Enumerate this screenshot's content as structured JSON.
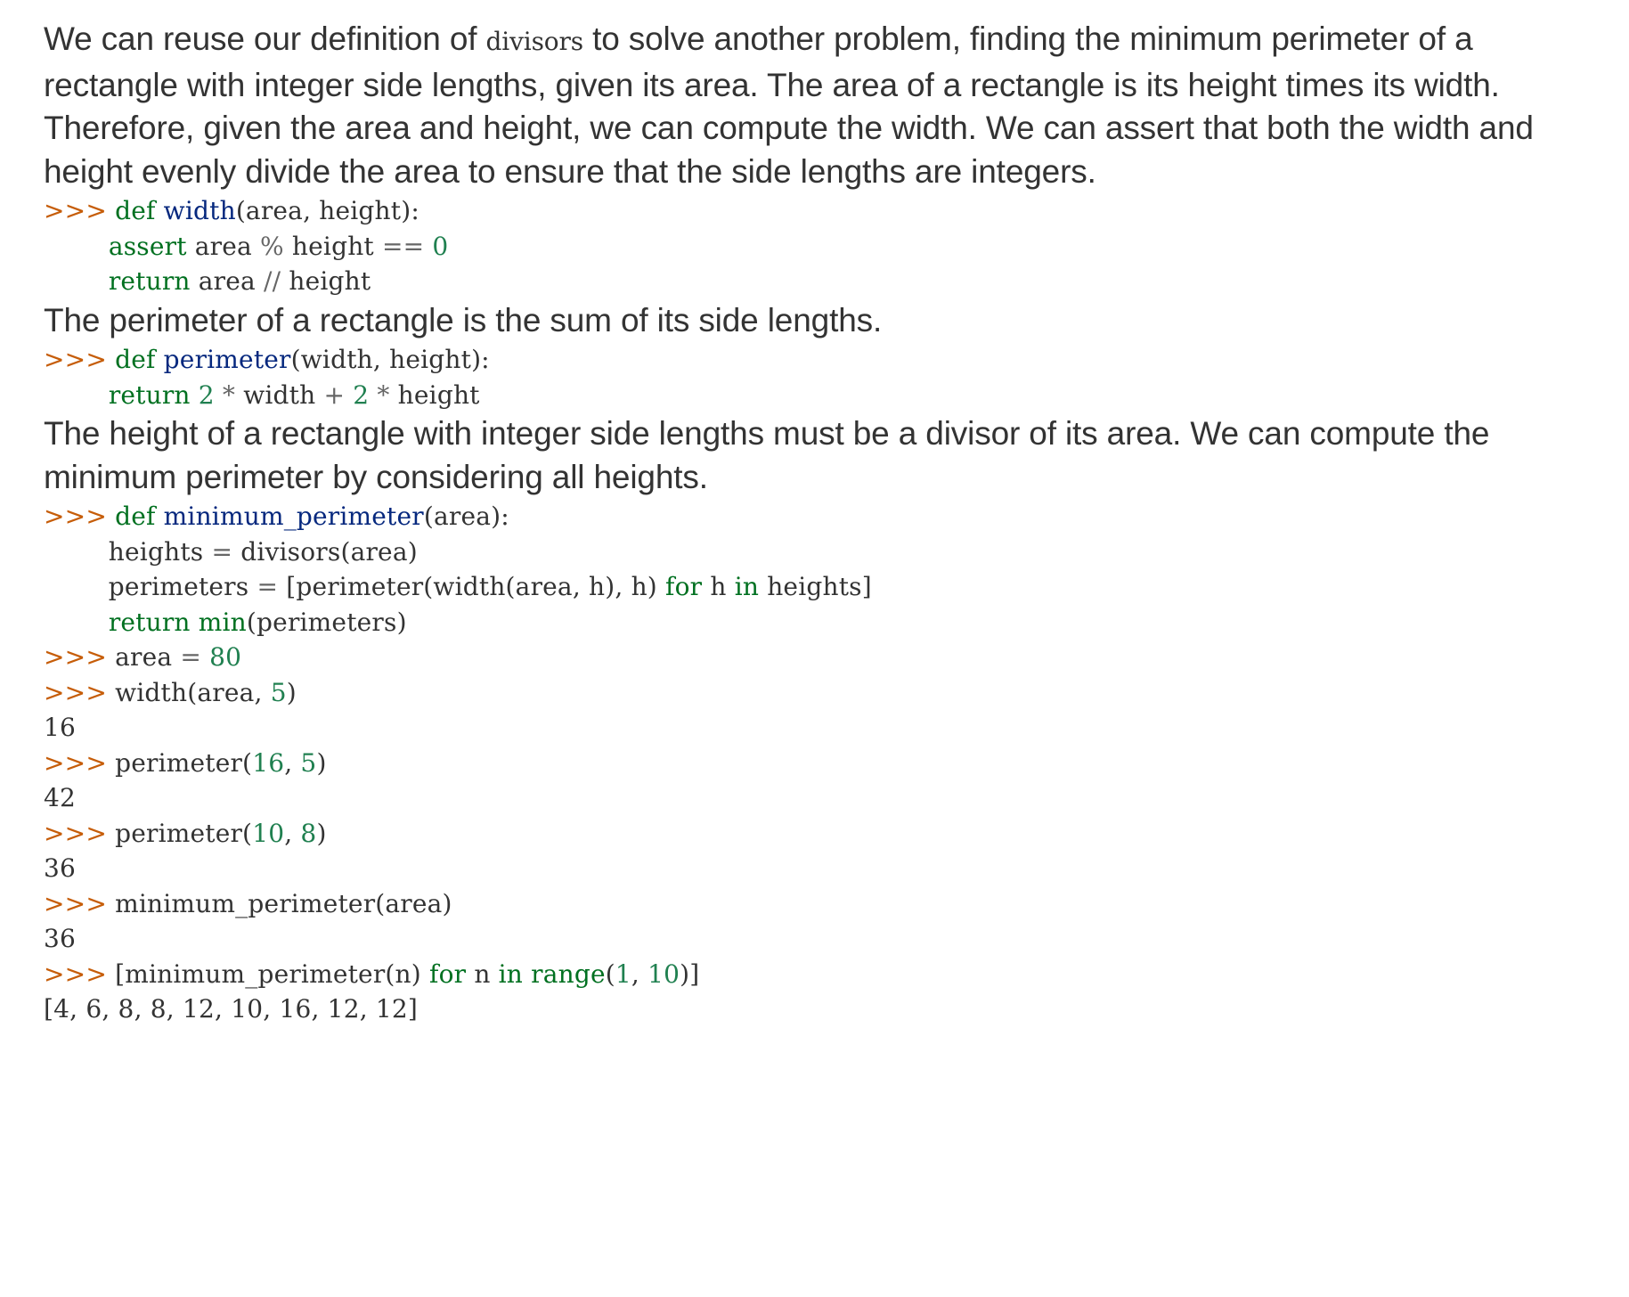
{
  "paragraph1": {
    "before": "We can reuse our definition of ",
    "code": "divisors",
    "after": " to solve another problem, finding the minimum perimeter of a rectangle with integer side lengths, given its area. The area of a rectangle is its height times its width. Therefore, given the area and height, we can compute the width. We can assert that both the width and height evenly divide the area to ensure that the side lengths are integers."
  },
  "paragraph2": "The perimeter of a rectangle is the sum of its side lengths.",
  "paragraph3": "The height of a rectangle with integer side lengths must be a divisor of its area. We can compute the minimum perimeter by considering all heights.",
  "code_width": [
    [
      [
        "prompt",
        ">>> "
      ],
      [
        "kw",
        "def"
      ],
      [
        "",
        " "
      ],
      [
        "fn",
        "width"
      ],
      [
        "",
        "(area, height):"
      ]
    ],
    [
      [
        "",
        "        "
      ],
      [
        "kw",
        "assert"
      ],
      [
        "",
        " area "
      ],
      [
        "op",
        "%"
      ],
      [
        "",
        " height "
      ],
      [
        "op",
        "=="
      ],
      [
        "",
        " "
      ],
      [
        "num",
        "0"
      ]
    ],
    [
      [
        "",
        "        "
      ],
      [
        "kw",
        "return"
      ],
      [
        "",
        " area "
      ],
      [
        "op",
        "//"
      ],
      [
        "",
        " height"
      ]
    ]
  ],
  "code_perimeter": [
    [
      [
        "prompt",
        ">>> "
      ],
      [
        "kw",
        "def"
      ],
      [
        "",
        " "
      ],
      [
        "fn",
        "perimeter"
      ],
      [
        "",
        "(width, height):"
      ]
    ],
    [
      [
        "",
        "        "
      ],
      [
        "kw",
        "return"
      ],
      [
        "",
        " "
      ],
      [
        "num",
        "2"
      ],
      [
        "",
        " "
      ],
      [
        "op",
        "*"
      ],
      [
        "",
        " width "
      ],
      [
        "op",
        "+"
      ],
      [
        "",
        " "
      ],
      [
        "num",
        "2"
      ],
      [
        "",
        " "
      ],
      [
        "op",
        "*"
      ],
      [
        "",
        " height"
      ]
    ]
  ],
  "code_minimum": [
    [
      [
        "prompt",
        ">>> "
      ],
      [
        "kw",
        "def"
      ],
      [
        "",
        " "
      ],
      [
        "fn",
        "minimum_perimeter"
      ],
      [
        "",
        "(area):"
      ]
    ],
    [
      [
        "",
        "        heights "
      ],
      [
        "op",
        "="
      ],
      [
        "",
        " divisors(area)"
      ]
    ],
    [
      [
        "",
        "        perimeters "
      ],
      [
        "op",
        "="
      ],
      [
        "",
        " [perimeter(width(area, h), h) "
      ],
      [
        "kw",
        "for"
      ],
      [
        "",
        " h "
      ],
      [
        "kw",
        "in"
      ],
      [
        "",
        " heights]"
      ]
    ],
    [
      [
        "",
        "        "
      ],
      [
        "kw",
        "return"
      ],
      [
        "",
        " "
      ],
      [
        "bi",
        "min"
      ],
      [
        "",
        "(perimeters)"
      ]
    ]
  ],
  "code_session": [
    [
      [
        "prompt",
        ">>> "
      ],
      [
        "",
        "area "
      ],
      [
        "op",
        "="
      ],
      [
        "",
        " "
      ],
      [
        "num",
        "80"
      ]
    ],
    [
      [
        "prompt",
        ">>> "
      ],
      [
        "",
        "width(area, "
      ],
      [
        "num",
        "5"
      ],
      [
        "",
        ")"
      ]
    ],
    [
      [
        "out",
        "16"
      ]
    ],
    [
      [
        "prompt",
        ">>> "
      ],
      [
        "",
        "perimeter("
      ],
      [
        "num",
        "16"
      ],
      [
        "",
        ", "
      ],
      [
        "num",
        "5"
      ],
      [
        "",
        ")"
      ]
    ],
    [
      [
        "out",
        "42"
      ]
    ],
    [
      [
        "prompt",
        ">>> "
      ],
      [
        "",
        "perimeter("
      ],
      [
        "num",
        "10"
      ],
      [
        "",
        ", "
      ],
      [
        "num",
        "8"
      ],
      [
        "",
        ")"
      ]
    ],
    [
      [
        "out",
        "36"
      ]
    ],
    [
      [
        "prompt",
        ">>> "
      ],
      [
        "",
        "minimum_perimeter(area)"
      ]
    ],
    [
      [
        "out",
        "36"
      ]
    ],
    [
      [
        "prompt",
        ">>> "
      ],
      [
        "",
        "[minimum_perimeter(n) "
      ],
      [
        "kw",
        "for"
      ],
      [
        "",
        " n "
      ],
      [
        "kw",
        "in"
      ],
      [
        "",
        " "
      ],
      [
        "bi",
        "range"
      ],
      [
        "",
        "("
      ],
      [
        "num",
        "1"
      ],
      [
        "",
        ", "
      ],
      [
        "num",
        "10"
      ],
      [
        "",
        ")]"
      ]
    ],
    [
      [
        "out",
        "[4, 6, 8, 8, 12, 10, 16, 12, 12]"
      ]
    ]
  ]
}
